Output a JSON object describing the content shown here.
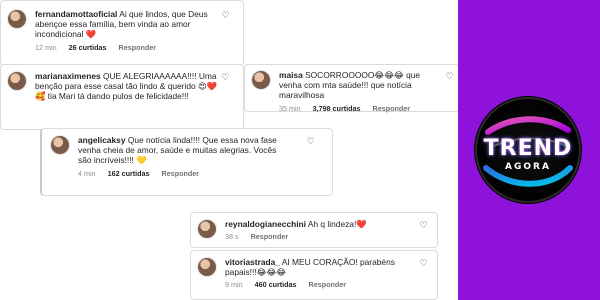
{
  "comments": [
    {
      "username": "fernandamottaoficial",
      "text": "Ai que lindos, que Deus abençoe essa família, bem vinda ao amor incondicional ❤️",
      "time": "12 min",
      "likes": "26 curtidas",
      "reply": "Responder"
    },
    {
      "username": "marianaximenes",
      "text": "QUE ALEGRIAAAAAA!!!! Uma benção para esse casal tão lindo & querido 😍❤️🥰 tia Mari tá dando pulos de felicidade!!!",
      "time": "",
      "likes": "",
      "reply": ""
    },
    {
      "username": "maisa",
      "text": "SOCORROOOOO😂😂😂 que venha com mta saúde!!! que notícia maravilhosa",
      "time": "35 min",
      "likes": "3,798 curtidas",
      "reply": "Responder"
    },
    {
      "username": "angelicaksy",
      "text": "Que notícia linda!!!! Que essa nova fase venha cheia de amor, saúde e muitas alegrias. Vocês são incríveis!!!! 💛",
      "time": "4 min",
      "likes": "162 curtidas",
      "reply": "Responder"
    },
    {
      "username": "reynaldogianecchini",
      "text": "Ah q lindeza!❤️",
      "time": "38 s",
      "likes": "",
      "reply": "Responder"
    },
    {
      "username": "vitoriastrada_",
      "text": "AI MEU CORAÇÃO! parabéns papais!!!😂😂😂",
      "time": "9 min",
      "likes": "460 curtidas",
      "reply": "Responder"
    }
  ],
  "logo": {
    "main": "TREND",
    "sub": "AGORA"
  },
  "colors": {
    "side_panel": "#8e12d9",
    "logo_pink": "#ff3fb4",
    "logo_blue": "#2f7bff"
  }
}
